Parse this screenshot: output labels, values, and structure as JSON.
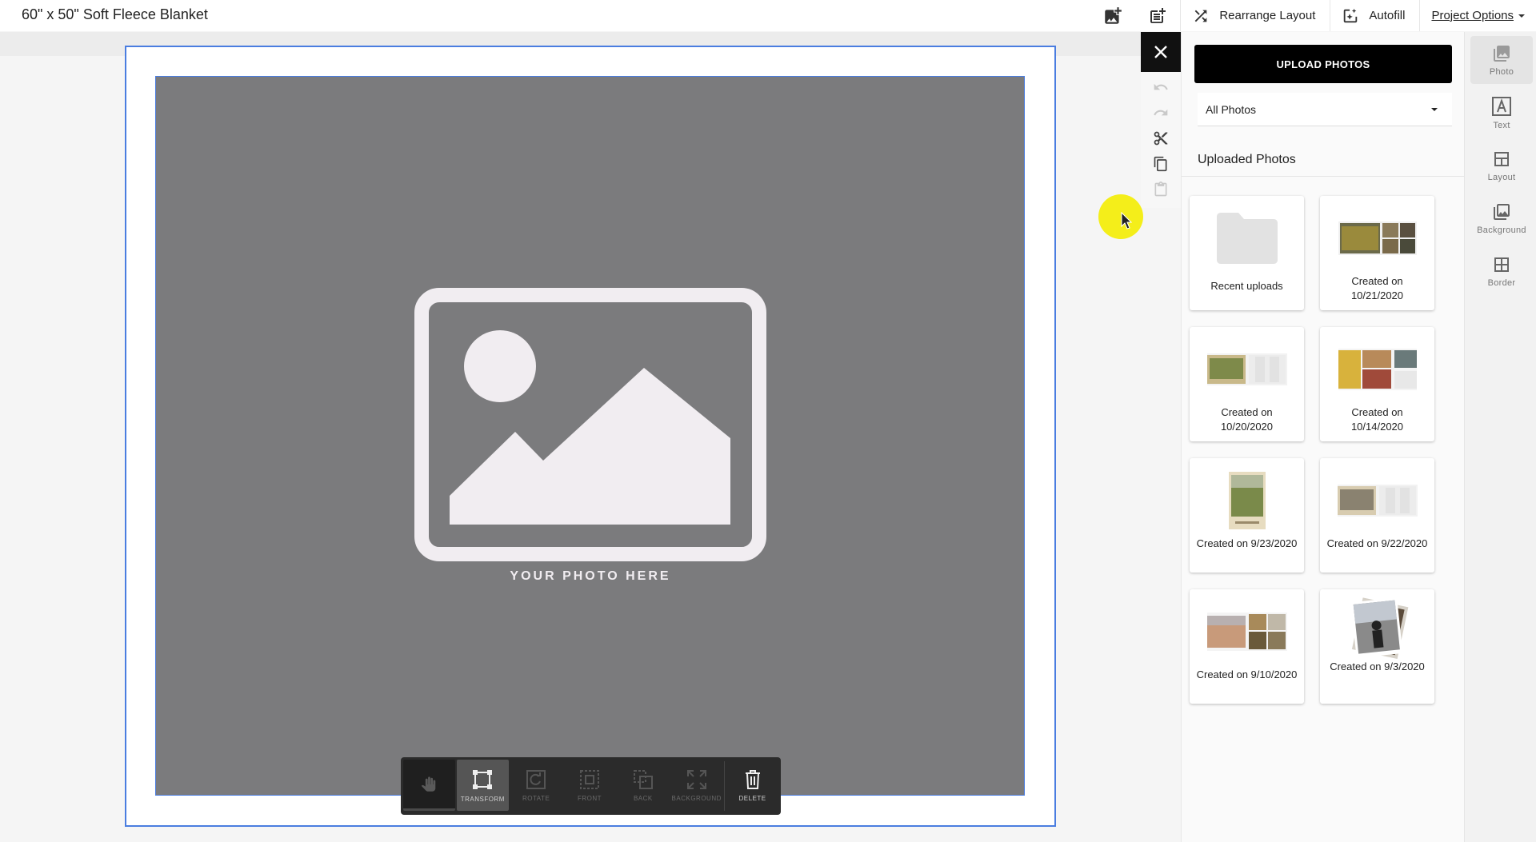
{
  "header": {
    "title": "60\" x 50\" Soft Fleece Blanket",
    "rearrange_label": "Rearrange Layout",
    "autofill_label": "Autofill",
    "project_options_label": "Project Options"
  },
  "canvas": {
    "placeholder_text": "YOUR PHOTO HERE"
  },
  "toolbar": {
    "tools": [
      {
        "label": "",
        "icon": "hand-icon",
        "state": "active"
      },
      {
        "label": "TRANSFORM",
        "icon": "transform-icon",
        "state": "selected"
      },
      {
        "label": "ROTATE",
        "icon": "rotate-icon",
        "state": "disabled"
      },
      {
        "label": "FRONT",
        "icon": "bring-front-icon",
        "state": "disabled"
      },
      {
        "label": "BACK",
        "icon": "send-back-icon",
        "state": "disabled"
      },
      {
        "label": "BACKGROUND",
        "icon": "expand-background-icon",
        "state": "disabled"
      },
      {
        "label": "DELETE",
        "icon": "trash-icon",
        "state": "enabled"
      }
    ]
  },
  "panel": {
    "upload_label": "UPLOAD PHOTOS",
    "filter_value": "All Photos",
    "section_title": "Uploaded Photos",
    "albums": [
      {
        "caption": "Recent uploads",
        "thumb": "folder-icon"
      },
      {
        "caption": "Created on 10/21/2020",
        "thumb": "photo-collage"
      },
      {
        "caption": "Created on 10/20/2020",
        "thumb": "photo-collage"
      },
      {
        "caption": "Created on 10/14/2020",
        "thumb": "photo-collage"
      },
      {
        "caption": "Created on 9/23/2020",
        "thumb": "photo-single"
      },
      {
        "caption": "Created on 9/22/2020",
        "thumb": "photo-collage"
      },
      {
        "caption": "Created on 9/10/2020",
        "thumb": "photo-collage"
      },
      {
        "caption": "Created on 9/3/2020",
        "thumb": "photo-stack"
      }
    ]
  },
  "rail": {
    "items": [
      {
        "label": "Photo",
        "icon": "photo-icon",
        "active": true
      },
      {
        "label": "Text",
        "icon": "text-icon",
        "active": false
      },
      {
        "label": "Layout",
        "icon": "layout-icon",
        "active": false
      },
      {
        "label": "Background",
        "icon": "background-icon",
        "active": false
      },
      {
        "label": "Border",
        "icon": "border-icon",
        "active": false
      }
    ]
  },
  "colors": {
    "selection": "#4a7de0",
    "slot": "#7b7b7d",
    "placeholder": "#f1edf1",
    "cursor_highlight": "#f4ee1a"
  }
}
